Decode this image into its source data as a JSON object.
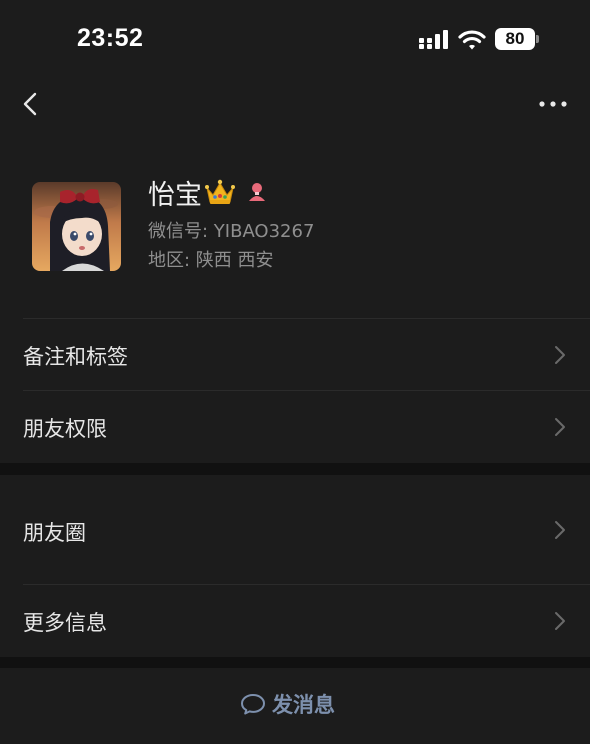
{
  "status_bar": {
    "time": "23:52",
    "battery": "80"
  },
  "nav": {
    "back_icon": "chevron-left-icon",
    "more_icon": "ellipsis-icon"
  },
  "profile": {
    "name": "怡宝",
    "wechat_id": "微信号: YIBAO3267",
    "region": "地区: 陕西 西安",
    "badge_icon": "crown-icon",
    "gender_icon": "female-gender-icon"
  },
  "menu": {
    "remarks_tags": "备注和标签",
    "friend_permissions": "朋友权限",
    "moments": "朋友圈",
    "more_info": "更多信息"
  },
  "bottom": {
    "send_message": "发消息"
  },
  "colors": {
    "background": "#1c1c1c",
    "section_gap": "#111111",
    "primary_text": "#e6e6e6",
    "secondary_text": "#8f8f8f",
    "link": "#7d90ad"
  }
}
